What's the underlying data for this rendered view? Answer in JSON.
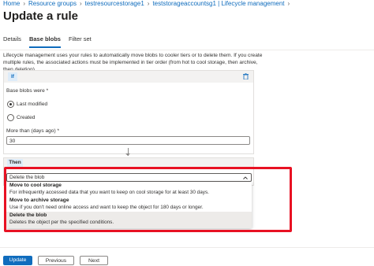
{
  "breadcrumb": {
    "items": [
      "Home",
      "Resource groups",
      "testresourcestorage1",
      "teststorageaccountsg1 | Lifecycle management"
    ]
  },
  "page": {
    "title": "Update a rule"
  },
  "tabs": [
    {
      "label": "Details",
      "active": false
    },
    {
      "label": "Base blobs",
      "active": true
    },
    {
      "label": "Filter set",
      "active": false
    }
  ],
  "description": "Lifecycle management uses your rules to automatically move blobs to cooler tiers or to delete them. If you create multiple rules, the associated actions must be implemented in tier order (from hot to cool storage, then archive, then deletion).",
  "if_section": {
    "tag": "If",
    "base_blobs_label": "Base blobs were *",
    "options": [
      {
        "label": "Last modified",
        "selected": true
      },
      {
        "label": "Created",
        "selected": false
      }
    ],
    "days_label": "More than (days ago) *",
    "days_value": "30"
  },
  "then_section": {
    "tag": "Then",
    "dropdown_value": "Delete the blob",
    "menu": [
      {
        "title": "Move to cool storage",
        "desc": "For infrequently accessed data that you want to keep on cool storage for at least 30 days."
      },
      {
        "title": "Move to archive storage",
        "desc": "Use if you don't need online access and want to keep the object for 180 days or longer."
      },
      {
        "title": "Delete the blob",
        "desc": "Deletes the object per the specified conditions.",
        "selected": true
      }
    ]
  },
  "footer": {
    "update_label": "Update",
    "previous_label": "Previous",
    "next_label": "Next"
  },
  "colors": {
    "accent": "#0f6cbd",
    "highlight": "#e81123"
  }
}
